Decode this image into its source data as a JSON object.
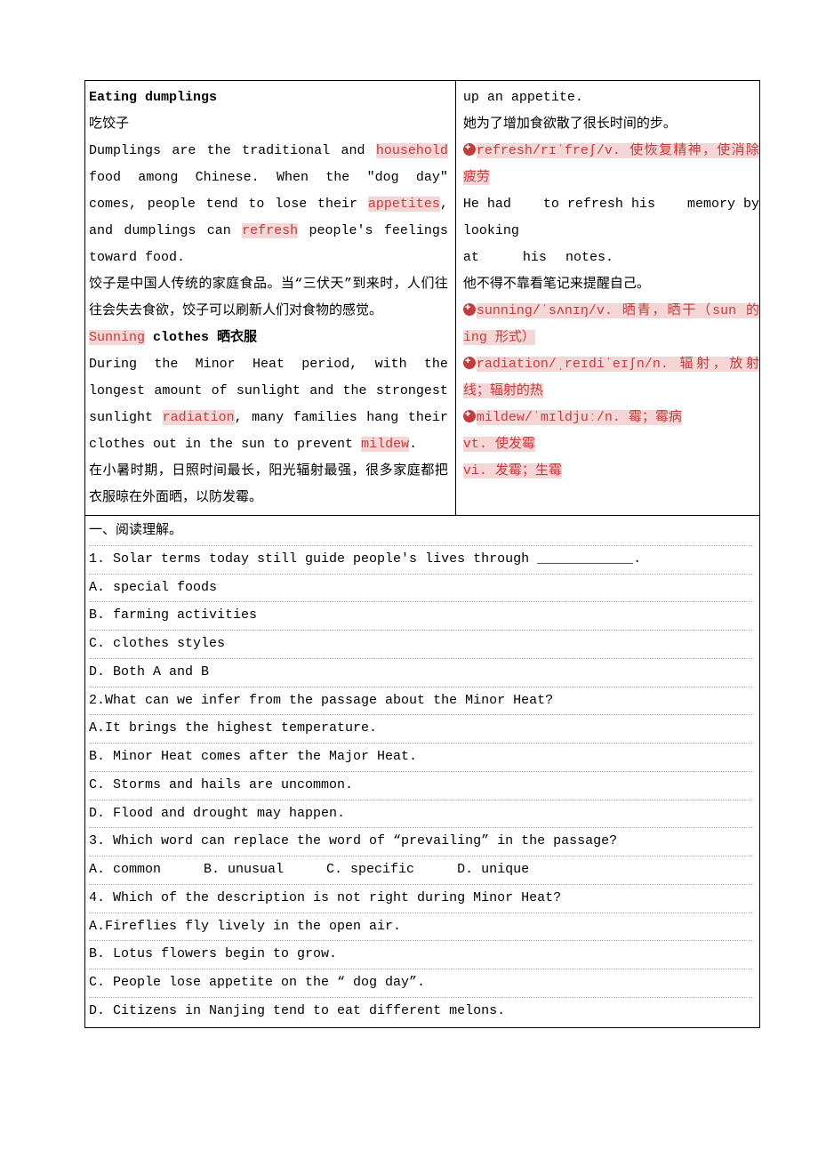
{
  "left": {
    "h1_en": "Eating dumplings",
    "h1_cn": "吃饺子",
    "p1a": "Dumplings are the traditional and ",
    "p1_hl1": "household",
    "p1b": " food among Chinese. When the \"dog day\" comes, people tend to lose their ",
    "p1_hl2": "appetites",
    "p1c": ", and dumplings can ",
    "p1_hl3": "refresh",
    "p1d": " people's feelings toward food.",
    "p1_cn": "饺子是中国人传统的家庭食品。当“三伏天”到来时，人们往往会失去食欲，饺子可以刷新人们对食物的感觉。",
    "h2_sun": "Sunning",
    "h2_rest": " clothes 晒衣服",
    "p2a": "During the Minor Heat period, with the longest amount of sunlight and the strongest sunlight ",
    "p2_hl1": "radiation",
    "p2b": ", many families hang their clothes out in the sun to prevent ",
    "p2_hl2": "mildew",
    "p2c": ".",
    "p2_cn": "在小暑时期，日照时间最长，阳光辐射最强，很多家庭都把衣服晾在外面晒，以防发霉。"
  },
  "right": {
    "r0": "up an appetite.",
    "r0_cn": "她为了增加食欲散了很长时间的步。",
    "r1": "refresh/rɪˈfreʃ/v. 使恢复精神，使消除疲劳",
    "r1_ex_en_a": "He  had",
    "r1_ex_en_b": "to refresh his",
    "r1_ex_en_c": "memory by",
    "r1_ex_en_d": "looking at",
    "r1_ex_en_e": "his",
    "r1_ex_en_f": "notes.",
    "r1_ex_cn": "他不得不靠看笔记来提醒自己。",
    "r2": "sunning/ˈsʌnɪŋ/v. 晒青，晒干（sun 的 ing 形式）",
    "r3": "radiation/ˌreɪdiˈeɪʃn/n. 辐射，放射线；辐射的热",
    "r4": "mildew/ˈmɪldjuː/n. 霉；霉病",
    "r4b": "vt. 使发霉",
    "r4c": "vi. 发霉；生霉"
  },
  "qa": {
    "head": "一、阅读理解。",
    "q1": "1. Solar terms today still guide people's lives through ____________.",
    "q1a": "A. special foods",
    "q1b": "B. farming activities",
    "q1c": "C. clothes styles",
    "q1d": "D. Both A and B",
    "q2": "2.What  can  we  infer  from  the passage  about  the Minor Heat?",
    "q2a": "A.It brings the highest temperature.",
    "q2b": "B. Minor Heat comes after the Major Heat.",
    "q2c": "C. Storms and hails are uncommon.",
    "q2d": "D. Flood and drought may happen.",
    "q3": "3. Which word can replace the word of “prevailing” in the passage?",
    "q3a": "A. common",
    "q3b": "B. unusual",
    "q3c": "C. specific",
    "q3d": "D. unique",
    "q4": "4. Which of the description is not right during Minor Heat?",
    "q4a": "A.Fireflies fly lively in the open air.",
    "q4b": "B. Lotus flowers begin to grow.",
    "q4c": "C. People lose appetite on the “ dog day”.",
    "q4d": "D. Citizens in Nanjing tend to eat different melons."
  }
}
